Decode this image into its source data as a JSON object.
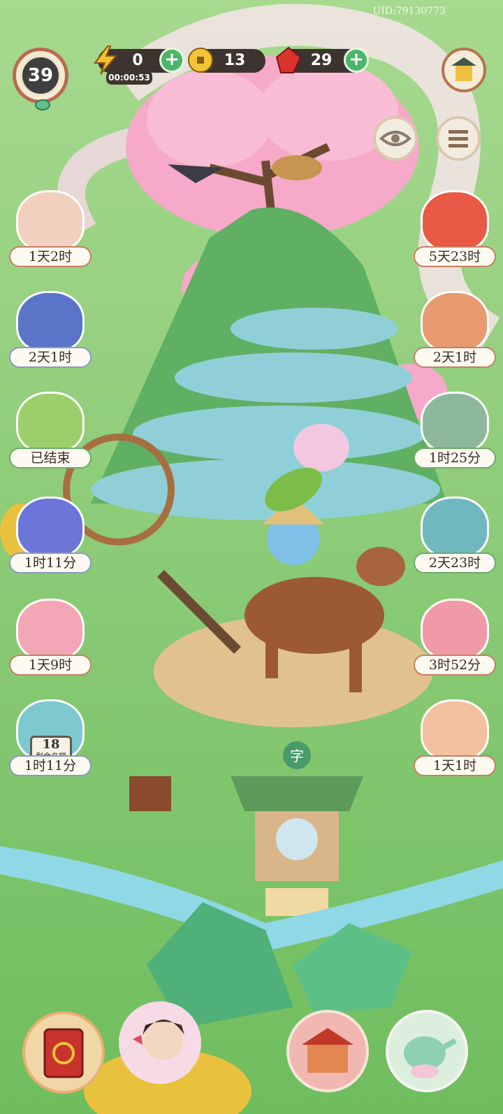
{
  "uid": "UID:79130773",
  "player": {
    "level": "39"
  },
  "resources": {
    "energy": {
      "icon": "lightning-icon",
      "value": "0",
      "timer": "00:00:53"
    },
    "coins": {
      "icon": "coin-icon",
      "value": "13"
    },
    "gems": {
      "icon": "ruby-icon",
      "value": "29"
    },
    "plus_symbol": "+"
  },
  "top_buttons": {
    "shop": "shop-icon",
    "view": "eye-icon",
    "menu": "list-menu-icon"
  },
  "left_events": [
    {
      "label": "1天2时",
      "icon": "couplet-book-icon"
    },
    {
      "label": "2天1时",
      "icon": "calico-cat-icon"
    },
    {
      "label": "已结束",
      "icon": "scarecrow-icon"
    },
    {
      "label": "1时11分",
      "icon": "swallow-kite-icon"
    },
    {
      "label": "1天9时",
      "icon": "mouse-icon"
    },
    {
      "label": "1时11分",
      "icon": "calendar-dragon-icon",
      "ticket_number": "18",
      "ticket_text": "剩余名额"
    }
  ],
  "right_events": [
    {
      "label": "5天23时",
      "icon": "fox-cat-icon"
    },
    {
      "label": "2天1时",
      "icon": "fan-cat-icon"
    },
    {
      "label": "1时25分",
      "icon": "cards-icon"
    },
    {
      "label": "2天23时",
      "icon": "jade-cat-gift-icon"
    },
    {
      "label": "3时52分",
      "icon": "red-box-icon"
    },
    {
      "label": "1天1时",
      "icon": "lucky-cat-icon"
    }
  ],
  "bottom_buttons": [
    "storybook-icon",
    "character-portrait-icon",
    "market-stall-icon",
    "teapot-icon"
  ],
  "shrine_sign": "字",
  "colors": {
    "grass": "#7cc46a",
    "blossom": "#f6a9c8",
    "label_border": "#c67f63",
    "pill": "#3d3430",
    "plus": "#4bb569"
  }
}
